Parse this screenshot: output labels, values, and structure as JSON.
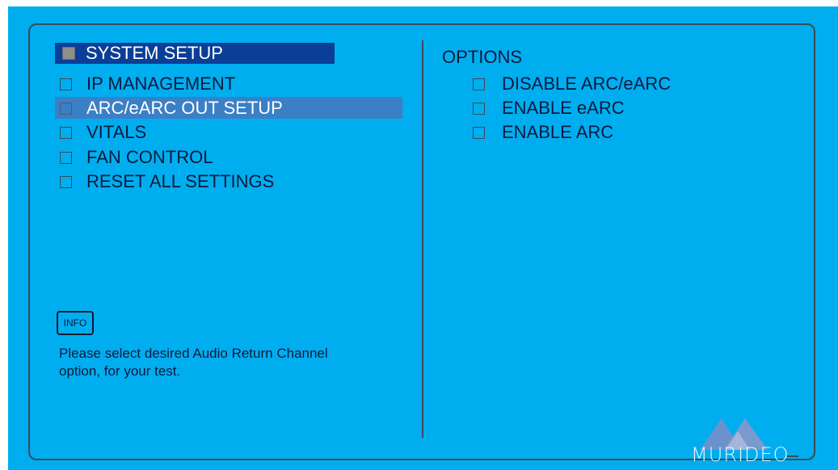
{
  "menu": {
    "title": "SYSTEM SETUP",
    "items": [
      {
        "label": "IP MANAGEMENT",
        "selected": false
      },
      {
        "label": "ARC/eARC OUT SETUP",
        "selected": true
      },
      {
        "label": "VITALS",
        "selected": false
      },
      {
        "label": "FAN CONTROL",
        "selected": false
      },
      {
        "label": "RESET ALL SETTINGS",
        "selected": false
      }
    ]
  },
  "info": {
    "badge": "INFO",
    "line1": "Please select desired Audio Return Channel",
    "line2": "option, for your test."
  },
  "options": {
    "title": "OPTIONS",
    "items": [
      {
        "label": "DISABLE ARC/eARC"
      },
      {
        "label": "ENABLE eARC"
      },
      {
        "label": "ENABLE ARC"
      }
    ]
  },
  "brand": {
    "name": "MURIDEO"
  },
  "colors": {
    "background": "#00aeef",
    "title_bar": "#0b3e96",
    "selection": "#3b7fc6",
    "text": "#0d1a3d"
  }
}
